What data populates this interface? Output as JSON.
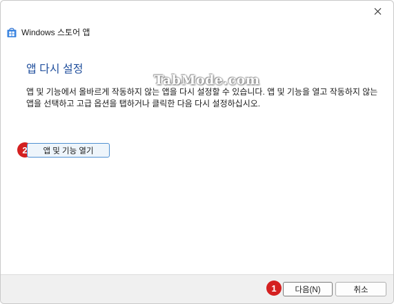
{
  "window": {
    "title": "Windows 스토어 앱"
  },
  "main": {
    "heading": "앱 다시 설정",
    "description": "앱 및 기능에서 올바르게 작동하지 않는 앱을 다시 설정할 수 있습니다. 앱 및 기능을 열고 작동하지 않는 앱을 선택하고 고급 옵션을 탭하거나 클릭한 다음 다시 설정하십시오.",
    "open_apps_button_label": "앱 및 기능 열기"
  },
  "footer": {
    "next_label": "다음(N)",
    "cancel_label": "취소"
  },
  "markers": {
    "first": "1",
    "second": "2"
  },
  "watermark": "TabMode.com",
  "colors": {
    "accent": "#1f4e9c",
    "marker": "#d42020",
    "button_border_focus": "#4d8fd1",
    "footer_bg": "#f0f0f0"
  },
  "icons": {
    "app": "windows-store-app-icon",
    "close": "close-icon"
  }
}
